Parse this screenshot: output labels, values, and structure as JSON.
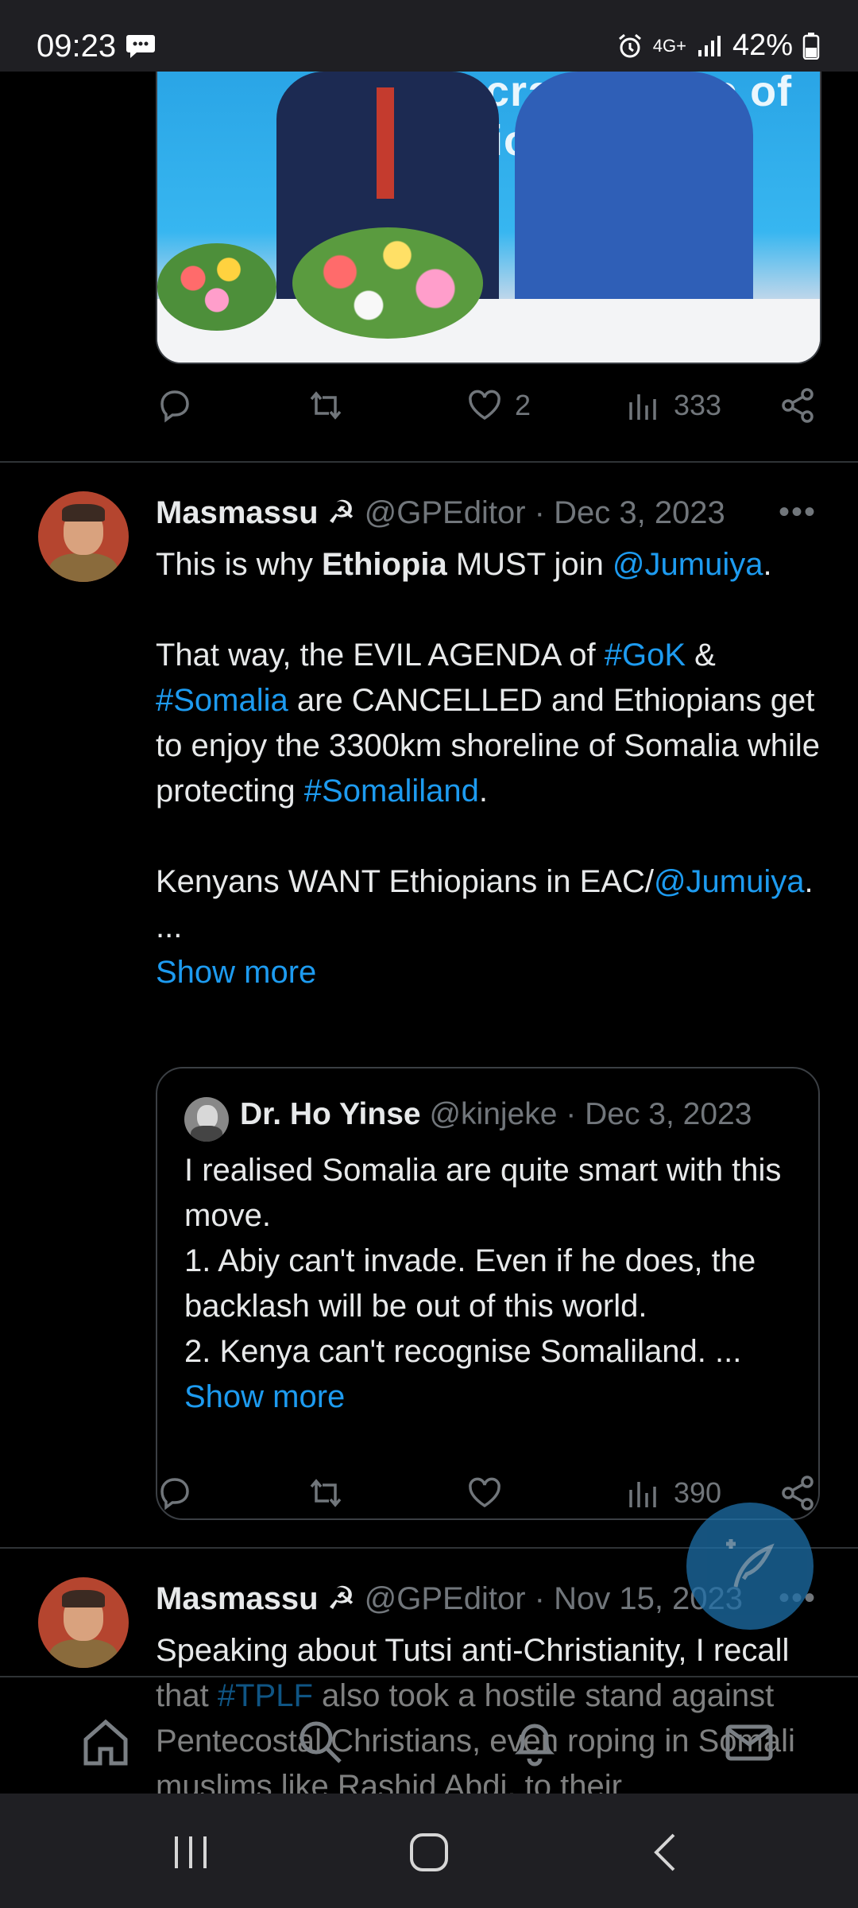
{
  "status": {
    "time": "09:23",
    "network": "4G+",
    "battery": "42%"
  },
  "tweet0": {
    "banner_text": "mocratic R...lic of Ethiop",
    "replies": "",
    "retweets": "",
    "likes": "2",
    "views": "333"
  },
  "tweet1": {
    "name": "Masmassu ☭",
    "handle": "@GPEditor",
    "sep": " · ",
    "date": "Dec 3, 2023",
    "body": {
      "p1_pre": "This is why ",
      "p1_bold": "Ethiopia",
      "p1_mid": " MUST join ",
      "p1_link": "@Jumuiya",
      "p1_post": ".",
      "p2_pre": "That way, the EVIL AGENDA of ",
      "p2_link1": "#GoK",
      "p2_mid1": " & ",
      "p2_link2": "#Somalia",
      "p2_mid2": " are CANCELLED and Ethiopians get to enjoy the 3300km shoreline of Somalia while protecting ",
      "p2_link3": "#Somaliland",
      "p2_post": ".",
      "p3_pre": "Kenyans WANT Ethiopians in EAC/",
      "p3_link": "@Jumuiya",
      "p3_post": ".",
      "ellipsis": "...",
      "show_more": "Show more"
    },
    "quote": {
      "name": "Dr. Ho Yinse",
      "handle": "@kinjeke",
      "sep": " · ",
      "date": "Dec 3, 2023",
      "line1": "I realised Somalia are quite smart with this move.",
      "line2": "1. Abiy can't invade. Even if he does, the backlash will be out of this world.",
      "line3": "2. Kenya can't recognise Somaliland. ...",
      "show_more": "Show more"
    },
    "views": "390"
  },
  "tweet2": {
    "name": "Masmassu ☭",
    "handle": "@GPEditor",
    "sep": " · ",
    "date": "Nov 15, 2023",
    "body_pre": "Speaking about Tutsi anti-Christianity, I recall that ",
    "body_link": "#TPLF",
    "body_post": " also took a hostile stand against Pentecostal Christians, even roping in Somali muslims like Rashid Abdi, to their"
  }
}
